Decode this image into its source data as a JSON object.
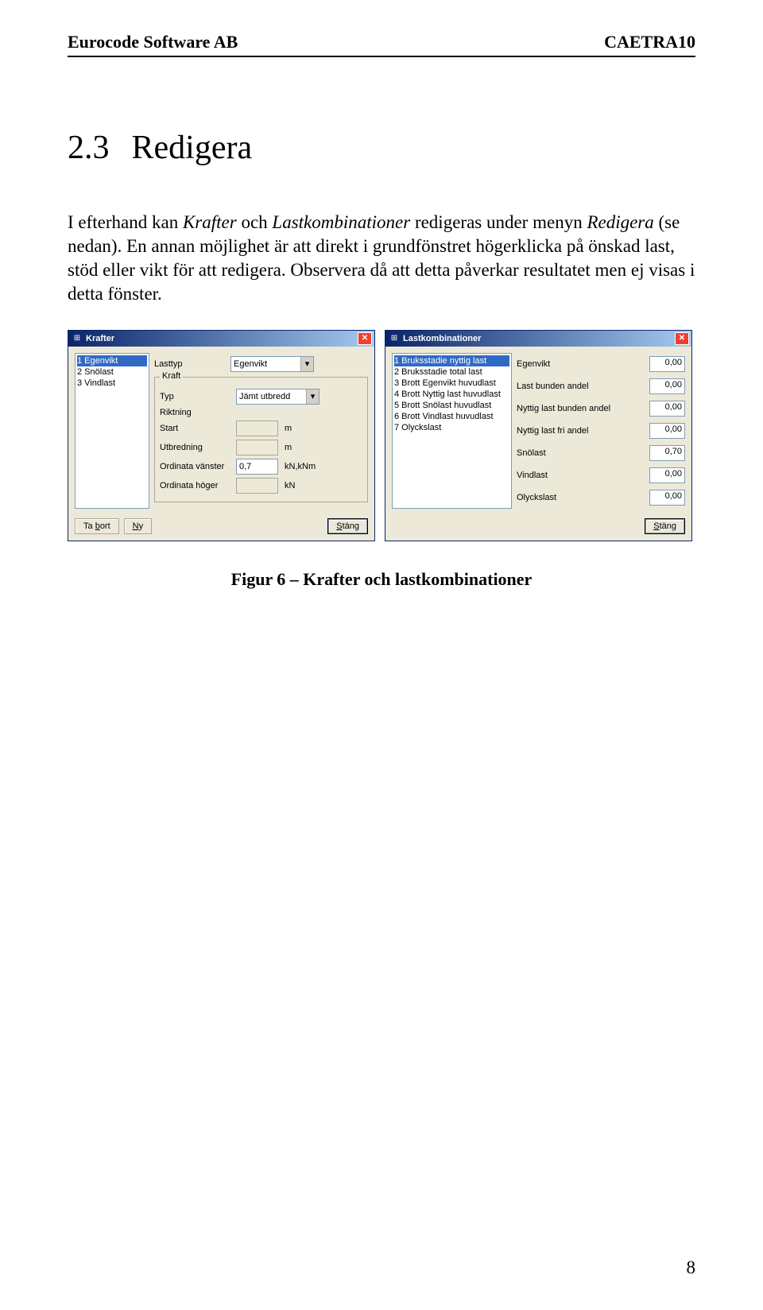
{
  "header": {
    "left": "Eurocode Software AB",
    "right": "CAETRA10"
  },
  "section": {
    "number": "2.3",
    "title": "Redigera"
  },
  "para1_a": "I efterhand kan ",
  "para1_b": "Krafter",
  "para1_c": " och ",
  "para1_d": "Lastkombinationer",
  "para1_e": " redigeras under menyn ",
  "para1_f": "Redigera",
  "para1_g": " (se nedan). En annan möjlighet är att direkt i grundfönstret högerklicka på önskad last, stöd eller vikt för att redigera. Observera då att detta påverkar resultatet men ej visas i detta fönster.",
  "caption": "Figur 6 – Krafter och lastkombinationer",
  "pagenum": "8",
  "krafter": {
    "title": "Krafter",
    "list": [
      "1 Egenvikt",
      "2 Snölast",
      "3 Vindlast"
    ],
    "lasttyp_label": "Lasttyp",
    "lasttyp_value": "Egenvikt",
    "group_label": "Kraft",
    "typ_label": "Typ",
    "typ_value": "Jämt utbredd",
    "riktning_label": "Riktning",
    "start_label": "Start",
    "start_unit": "m",
    "utbredning_label": "Utbredning",
    "utbredning_unit": "m",
    "ordv_label": "Ordinata vänster",
    "ordv_value": "0,7",
    "ordv_unit": "kN,kNm",
    "ordh_label": "Ordinata höger",
    "ordh_unit": "kN",
    "btn_tabort": "Ta bort",
    "btn_ny": "Ny",
    "btn_stang": "Stäng"
  },
  "lastkomb": {
    "title": "Lastkombinationer",
    "list": [
      "1 Bruksstadie nyttig last",
      "2 Bruksstadie total last",
      "3 Brott Egenvikt huvudlast",
      "4 Brott Nyttig last huvudlast",
      "5 Brott Snölast huvudlast",
      "6 Brott Vindlast huvudlast",
      "7 Olyckslast"
    ],
    "rows": [
      {
        "label": "Egenvikt",
        "value": "0,00"
      },
      {
        "label": "Last bunden andel",
        "value": "0,00"
      },
      {
        "label": "Nyttig last bunden andel",
        "value": "0,00"
      },
      {
        "label": "Nyttig last fri andel",
        "value": "0,00"
      },
      {
        "label": "Snölast",
        "value": "0,70"
      },
      {
        "label": "Vindlast",
        "value": "0,00"
      },
      {
        "label": "Olyckslast",
        "value": "0,00"
      }
    ],
    "btn_stang": "Stäng"
  }
}
